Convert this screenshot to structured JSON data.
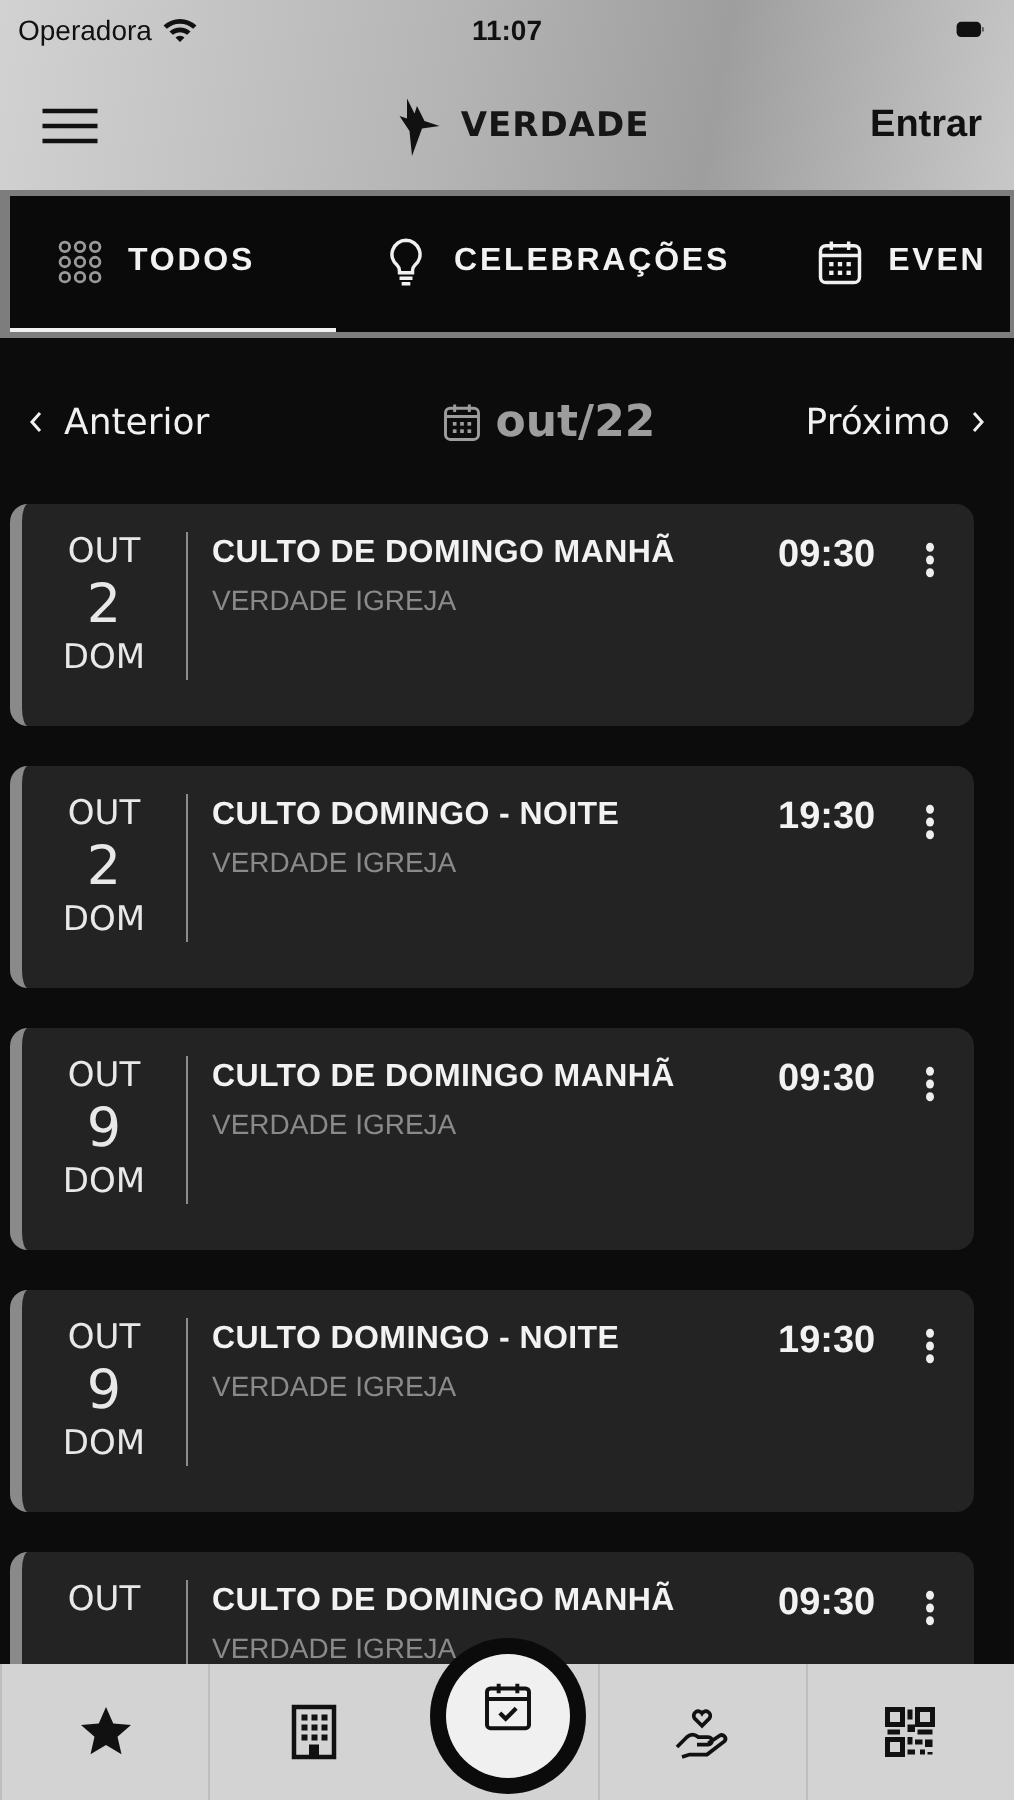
{
  "status_bar": {
    "carrier": "Operadora",
    "time": "11:07"
  },
  "header": {
    "logo_text": "VERDADE",
    "login": "Entrar"
  },
  "tabs": [
    {
      "kind": "grid",
      "label": "TODOS",
      "selected": true
    },
    {
      "kind": "bulb",
      "label": "CELEBRAÇÕES",
      "selected": false
    },
    {
      "kind": "calendar",
      "label": "EVEN",
      "selected": false
    }
  ],
  "month_nav": {
    "previous": "Anterior",
    "month": "out/22",
    "next": "Próximo"
  },
  "events": [
    {
      "month": "OUT",
      "day": "2",
      "weekday": "DOM",
      "title": "CULTO DE DOMINGO MANHÃ",
      "place": "VERDADE IGREJA",
      "time": "09:30"
    },
    {
      "month": "OUT",
      "day": "2",
      "weekday": "DOM",
      "title": "CULTO DOMINGO - NOITE",
      "place": "VERDADE IGREJA",
      "time": "19:30"
    },
    {
      "month": "OUT",
      "day": "9",
      "weekday": "DOM",
      "title": "CULTO DE DOMINGO MANHÃ",
      "place": "VERDADE IGREJA",
      "time": "09:30"
    },
    {
      "month": "OUT",
      "day": "9",
      "weekday": "DOM",
      "title": "CULTO DOMINGO - NOITE",
      "place": "VERDADE IGREJA",
      "time": "19:30"
    },
    {
      "month": "OUT",
      "title": "CULTO DE DOMINGO MANHÃ",
      "place": "VERDADE IGREJA",
      "time": "09:30"
    }
  ],
  "bottom_nav": [
    {
      "kind": "star",
      "selected": false
    },
    {
      "kind": "building",
      "selected": false
    },
    {
      "kind": "calendar-check",
      "selected": true
    },
    {
      "kind": "heart-hand",
      "selected": false
    },
    {
      "kind": "qr",
      "selected": false
    }
  ]
}
